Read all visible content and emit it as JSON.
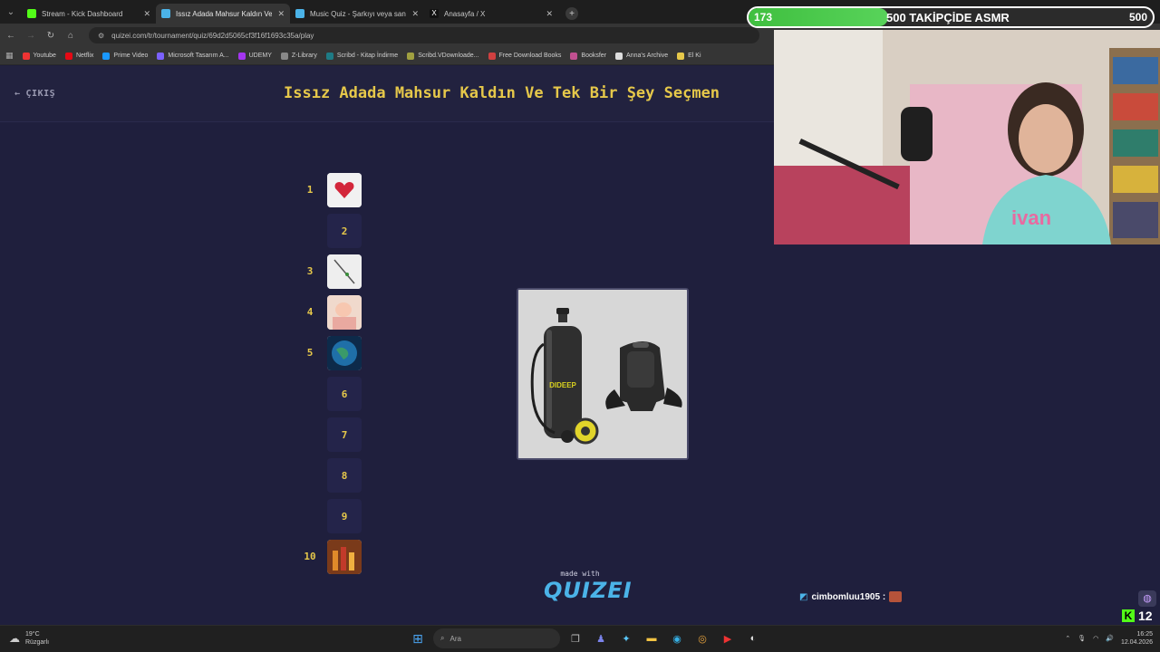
{
  "browser": {
    "tabs": [
      {
        "title": "Stream - Kick Dashboard",
        "active": false,
        "favicon_color": "#53fc18"
      },
      {
        "title": "Issız Adada Mahsur Kaldın Ve T",
        "active": true,
        "favicon_color": "#4bb3e8"
      },
      {
        "title": "Music Quiz - Şarkıyı veya sanat",
        "active": false,
        "favicon_color": "#4bb3e8"
      },
      {
        "title": "Anasayfa / X",
        "active": false,
        "favicon_color": "#ffffff"
      }
    ],
    "url": "quizei.com/tr/tournament/quiz/69d2d5065cf3f16f1693c35a/play",
    "bookmarks": [
      {
        "label": "Youtube",
        "color": "#e33"
      },
      {
        "label": "Netflix",
        "color": "#e50914"
      },
      {
        "label": "Prime Video",
        "color": "#1a98ff"
      },
      {
        "label": "Microsoft Tasarım A...",
        "color": "#7b61ff"
      },
      {
        "label": "UDEMY",
        "color": "#a435f0"
      },
      {
        "label": "Z-Library",
        "color": "#888"
      },
      {
        "label": "Scribd - Kitap İndirme",
        "color": "#1e7b85"
      },
      {
        "label": "Scribd.VDownloade...",
        "color": "#a0a040"
      },
      {
        "label": "Free Download Books",
        "color": "#d04040"
      },
      {
        "label": "Booksfer",
        "color": "#c05090"
      },
      {
        "label": "Anna's Archive",
        "color": "#ddd"
      },
      {
        "label": "El Ki",
        "color": "#e6c84a"
      }
    ]
  },
  "page": {
    "exit_label": "ÇIKIŞ",
    "title": "Issız Adada Mahsur Kaldın Ve Tek Bir Şey Seçmen",
    "ranks": [
      {
        "n": "1",
        "filled": true,
        "thumb": "heart-pillow"
      },
      {
        "n": "2",
        "filled": false
      },
      {
        "n": "3",
        "filled": true,
        "thumb": "fishing-rod"
      },
      {
        "n": "4",
        "filled": true,
        "thumb": "baby-photo"
      },
      {
        "n": "5",
        "filled": true,
        "thumb": "earth-globe"
      },
      {
        "n": "6",
        "filled": false
      },
      {
        "n": "7",
        "filled": false
      },
      {
        "n": "8",
        "filled": false
      },
      {
        "n": "9",
        "filled": false
      },
      {
        "n": "10",
        "filled": true,
        "thumb": "bottles"
      }
    ],
    "current_item": {
      "image": "scuba-tank-with-backpack",
      "brand_text": "DIDEEP"
    },
    "made_with": "made with",
    "logo": "QUIZEI"
  },
  "overlay": {
    "goal_current": "173",
    "goal_label": "500 TAKİPÇİDE ASMR",
    "goal_target": "500",
    "goal_progress": 0.346,
    "chat_user": "cimbomluu1905 :",
    "viewer_count": "12"
  },
  "taskbar": {
    "temp": "19°C",
    "weather": "Rüzgarlı",
    "search": "Ara",
    "time": "16:25",
    "date": "12.04.2026"
  }
}
